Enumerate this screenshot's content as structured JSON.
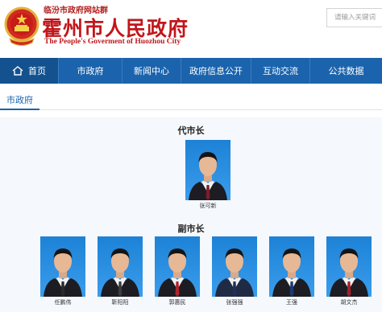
{
  "header": {
    "portal_line": "临汾市政府网站群",
    "title": "霍州市人民政府",
    "subtitle": "The People's Goverment of Huozhou City",
    "search_placeholder": "请输入关键词"
  },
  "nav": {
    "items": [
      "首页",
      "市政府",
      "新闻中心",
      "政府信息公开",
      "互动交流",
      "公共数据"
    ]
  },
  "section_tab": "市政府",
  "groups": {
    "acting_mayor": {
      "title": "代市长",
      "people": [
        {
          "name": "张可新",
          "tie": "#7a1f2b",
          "uniform": false
        }
      ]
    },
    "vice_mayors": {
      "title": "副市长",
      "people": [
        {
          "name": "任鹏伟",
          "tie": "#2a2a2a",
          "uniform": false
        },
        {
          "name": "靳阳阳",
          "tie": "#3b3b3b",
          "uniform": false
        },
        {
          "name": "郭惠民",
          "tie": "#b0242a",
          "uniform": false
        },
        {
          "name": "张强强",
          "tie": "#1e2f5a",
          "uniform": true
        },
        {
          "name": "王强",
          "tie": "#1e3a70",
          "uniform": false
        },
        {
          "name": "胡文杰",
          "tie": "#a0202a",
          "uniform": false
        }
      ]
    }
  },
  "colors": {
    "brand_red": "#c2161a",
    "nav_blue": "#1b64ad"
  }
}
